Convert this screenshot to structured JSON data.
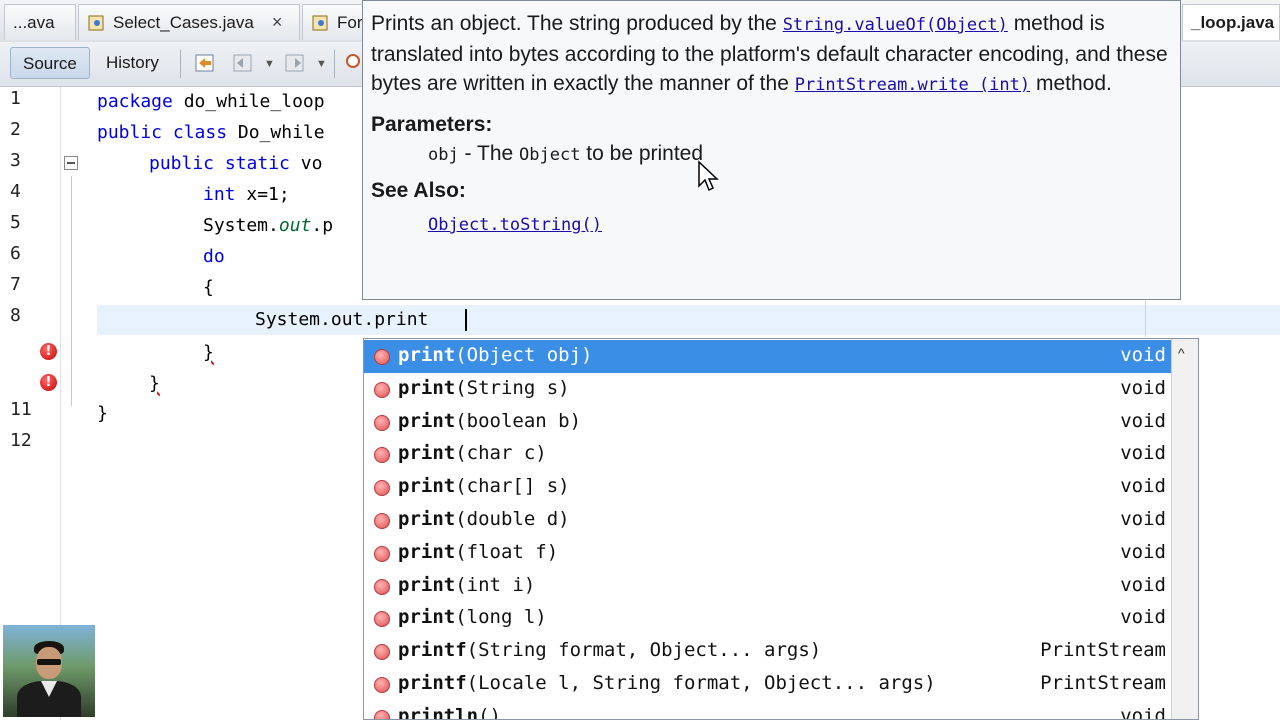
{
  "tabs": [
    {
      "label": "...ava"
    },
    {
      "label": "Select_Cases.java",
      "close": "×"
    },
    {
      "label": "For"
    },
    {
      "label": "_loop.java"
    }
  ],
  "toolbar": {
    "source_label": "Source",
    "history_label": "History"
  },
  "editor": {
    "line_numbers": [
      "1",
      "2",
      "3",
      "4",
      "5",
      "6",
      "7",
      "8",
      "",
      "",
      "11",
      "12"
    ],
    "error_glyph": "!",
    "lines": {
      "l1_kw": "package",
      "l1_rest": " do_while_loop",
      "l2_kw": "public class",
      "l2_rest": " Do_while",
      "l3_kw": "public static",
      "l3_rest": " vo",
      "l4_kw": "int",
      "l4_rest": " x=1;",
      "l5_a": "System.",
      "l5_b": "out",
      "l5_c": ".p",
      "l6_kw": "do",
      "l7": "{",
      "l8": "System.out.print",
      "l9": "}",
      "l10": "}",
      "l11": "}"
    }
  },
  "javadoc": {
    "p1_a": "Prints an object. The string produced by the ",
    "p1_link1": "String.valueOf(Object)",
    "p1_b": " method is translated into bytes according to the platform's default character encoding, and these bytes are written in exactly the manner of the ",
    "p1_link2": "PrintStream.write (int)",
    "p1_c": " method.",
    "params_heading": "Parameters:",
    "param_name": "obj",
    "param_a": " - The ",
    "param_type": "Object",
    "param_b": " to be printed",
    "see_heading": "See Also:",
    "see_link": "Object.toString()"
  },
  "completion": {
    "items": [
      {
        "name": "print",
        "params": "(Object obj)",
        "ret": "void"
      },
      {
        "name": "print",
        "params": "(String s)",
        "ret": "void"
      },
      {
        "name": "print",
        "params": "(boolean b)",
        "ret": "void"
      },
      {
        "name": "print",
        "params": "(char c)",
        "ret": "void"
      },
      {
        "name": "print",
        "params": "(char[] s)",
        "ret": "void"
      },
      {
        "name": "print",
        "params": "(double d)",
        "ret": "void"
      },
      {
        "name": "print",
        "params": "(float f)",
        "ret": "void"
      },
      {
        "name": "print",
        "params": "(int i)",
        "ret": "void"
      },
      {
        "name": "print",
        "params": "(long l)",
        "ret": "void"
      },
      {
        "name": "printf",
        "params": "(String format, Object... args)",
        "ret": "PrintStream"
      },
      {
        "name": "printf",
        "params": "(Locale l, String format, Object... args)",
        "ret": "PrintStream"
      },
      {
        "name": "println",
        "params": "()",
        "ret": "void"
      }
    ],
    "scroll_up": "^"
  },
  "colors": {
    "selection": "#3a8ee6",
    "keyword": "#0000e6",
    "current_line": "#e8f2fe"
  }
}
